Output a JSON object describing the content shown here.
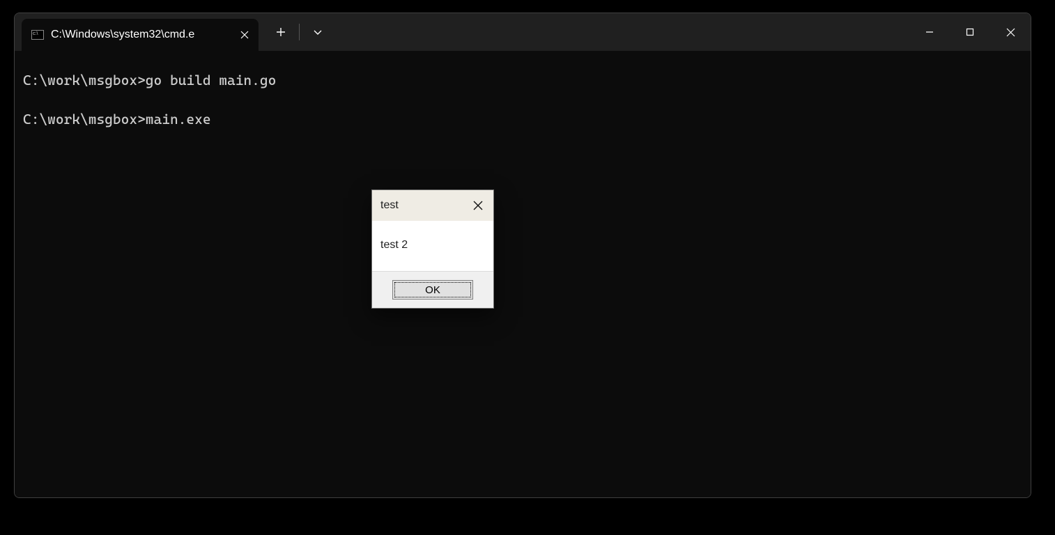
{
  "window": {
    "tab": {
      "title": "C:\\Windows\\system32\\cmd.e"
    }
  },
  "terminal": {
    "lines": [
      {
        "prompt": "C:\\work\\msgbox>",
        "cmd": "go build main.go"
      },
      {
        "prompt": "C:\\work\\msgbox>",
        "cmd": "main.exe"
      }
    ]
  },
  "msgbox": {
    "title": "test",
    "message": "test 2",
    "ok_label": "OK"
  }
}
